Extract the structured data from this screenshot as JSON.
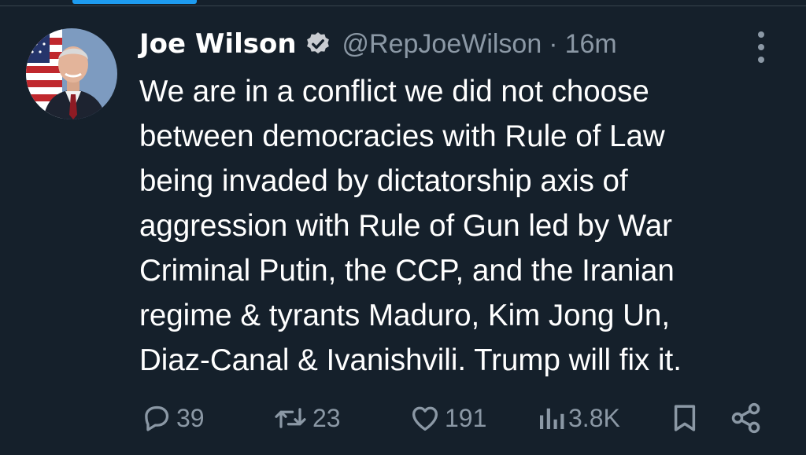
{
  "author": {
    "name": "Joe Wilson",
    "handle": "@RepJoeWilson",
    "separator": "·",
    "time": "16m",
    "verified": true
  },
  "tweet": {
    "lines": [
      "We are in a conflict we did not choose",
      "between democracies with Rule of Law",
      "being invaded by dictatorship axis of",
      "aggression with Rule of Gun led by War",
      "Criminal Putin, the CCP, and the Iranian",
      "regime & tyrants Maduro, Kim Jong Un,",
      "Diaz-Canal & Ivanishvili. Trump will fix it."
    ]
  },
  "actions": {
    "replies": "39",
    "reposts": "23",
    "likes": "191",
    "views": "3.8K"
  },
  "icons": {
    "verified": "verified-badge-icon",
    "more": "more-options-icon",
    "reply": "reply-icon",
    "repost": "repost-icon",
    "like": "heart-icon",
    "views": "views-bar-chart-icon",
    "bookmark": "bookmark-icon",
    "share": "share-icon"
  },
  "colors": {
    "background": "#15202b",
    "text": "#ffffff",
    "muted": "#8b98a5",
    "accent": "#1d9bf0",
    "verified_badge": "#c9ccd1"
  }
}
